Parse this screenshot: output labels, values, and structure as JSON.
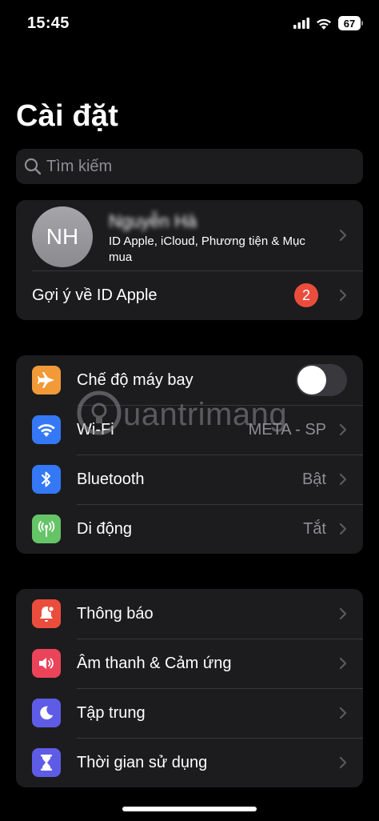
{
  "status_bar": {
    "time": "15:45",
    "battery": "67"
  },
  "title": "Cài đặt",
  "search": {
    "placeholder": "Tìm kiếm"
  },
  "profile": {
    "initials": "NH",
    "name": "Nguyễn Hà",
    "subtitle": "ID Apple, iCloud, Phương tiện & Mục mua",
    "suggestion_label": "Gợi ý về ID Apple",
    "suggestion_count": "2"
  },
  "connectivity": [
    {
      "label": "Chế độ máy bay",
      "icon": "airplane-icon",
      "color": "#f19a37",
      "toggle": false
    },
    {
      "label": "Wi-Fi",
      "icon": "wifi-icon",
      "color": "#3478f6",
      "value": "META - SP"
    },
    {
      "label": "Bluetooth",
      "icon": "bluetooth-icon",
      "color": "#3478f6",
      "value": "Bật"
    },
    {
      "label": "Di động",
      "icon": "cellular-icon",
      "color": "#65c466",
      "value": "Tắt"
    }
  ],
  "notifications_group": [
    {
      "label": "Thông báo",
      "icon": "bell-icon",
      "color": "#eb4d3d"
    },
    {
      "label": "Âm thanh & Cảm ứng",
      "icon": "speaker-icon",
      "color": "#eb445a"
    },
    {
      "label": "Tập trung",
      "icon": "moon-icon",
      "color": "#5e5ce6"
    },
    {
      "label": "Thời gian sử dụng",
      "icon": "hourglass-icon",
      "color": "#5e5ce6"
    }
  ],
  "watermark": "uantrimang"
}
